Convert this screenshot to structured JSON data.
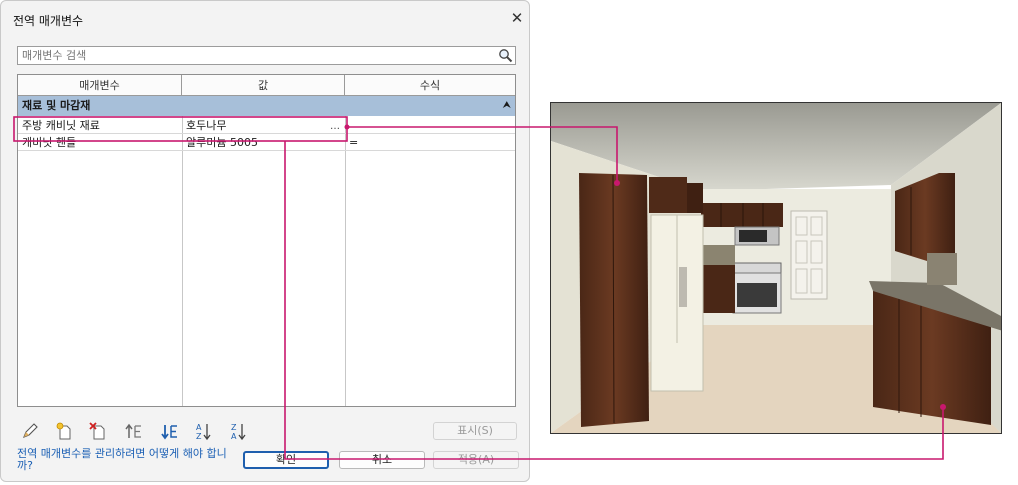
{
  "dialog": {
    "title": "전역 매개변수",
    "search_placeholder": "매개변수 검색",
    "columns": [
      "매개변수",
      "값",
      "수식"
    ],
    "group": {
      "label": "재료 및 마감재"
    },
    "rows": [
      {
        "name": "주방 캐비닛 재료",
        "value": "호두나무",
        "formula": ""
      },
      {
        "name": "캐비닛 핸들",
        "value": "알루미늄 5005",
        "formula": "="
      }
    ],
    "show_button": "표시(S)",
    "link": "전역 매개변수를 관리하려면 어떻게 해야 합니까?",
    "ok_button": "확인",
    "cancel_button": "취소",
    "apply_button": "적용(A)"
  },
  "colors": {
    "group_header": "#a7bfd9",
    "callout": "#c8186e",
    "link": "#1a5fb4"
  },
  "icons": [
    "close-icon",
    "search-icon",
    "edit-icon",
    "new-parameter-icon",
    "delete-parameter-icon",
    "move-up-icon",
    "move-down-icon",
    "sort-ascending-icon",
    "sort-descending-icon",
    "browse-icon"
  ]
}
